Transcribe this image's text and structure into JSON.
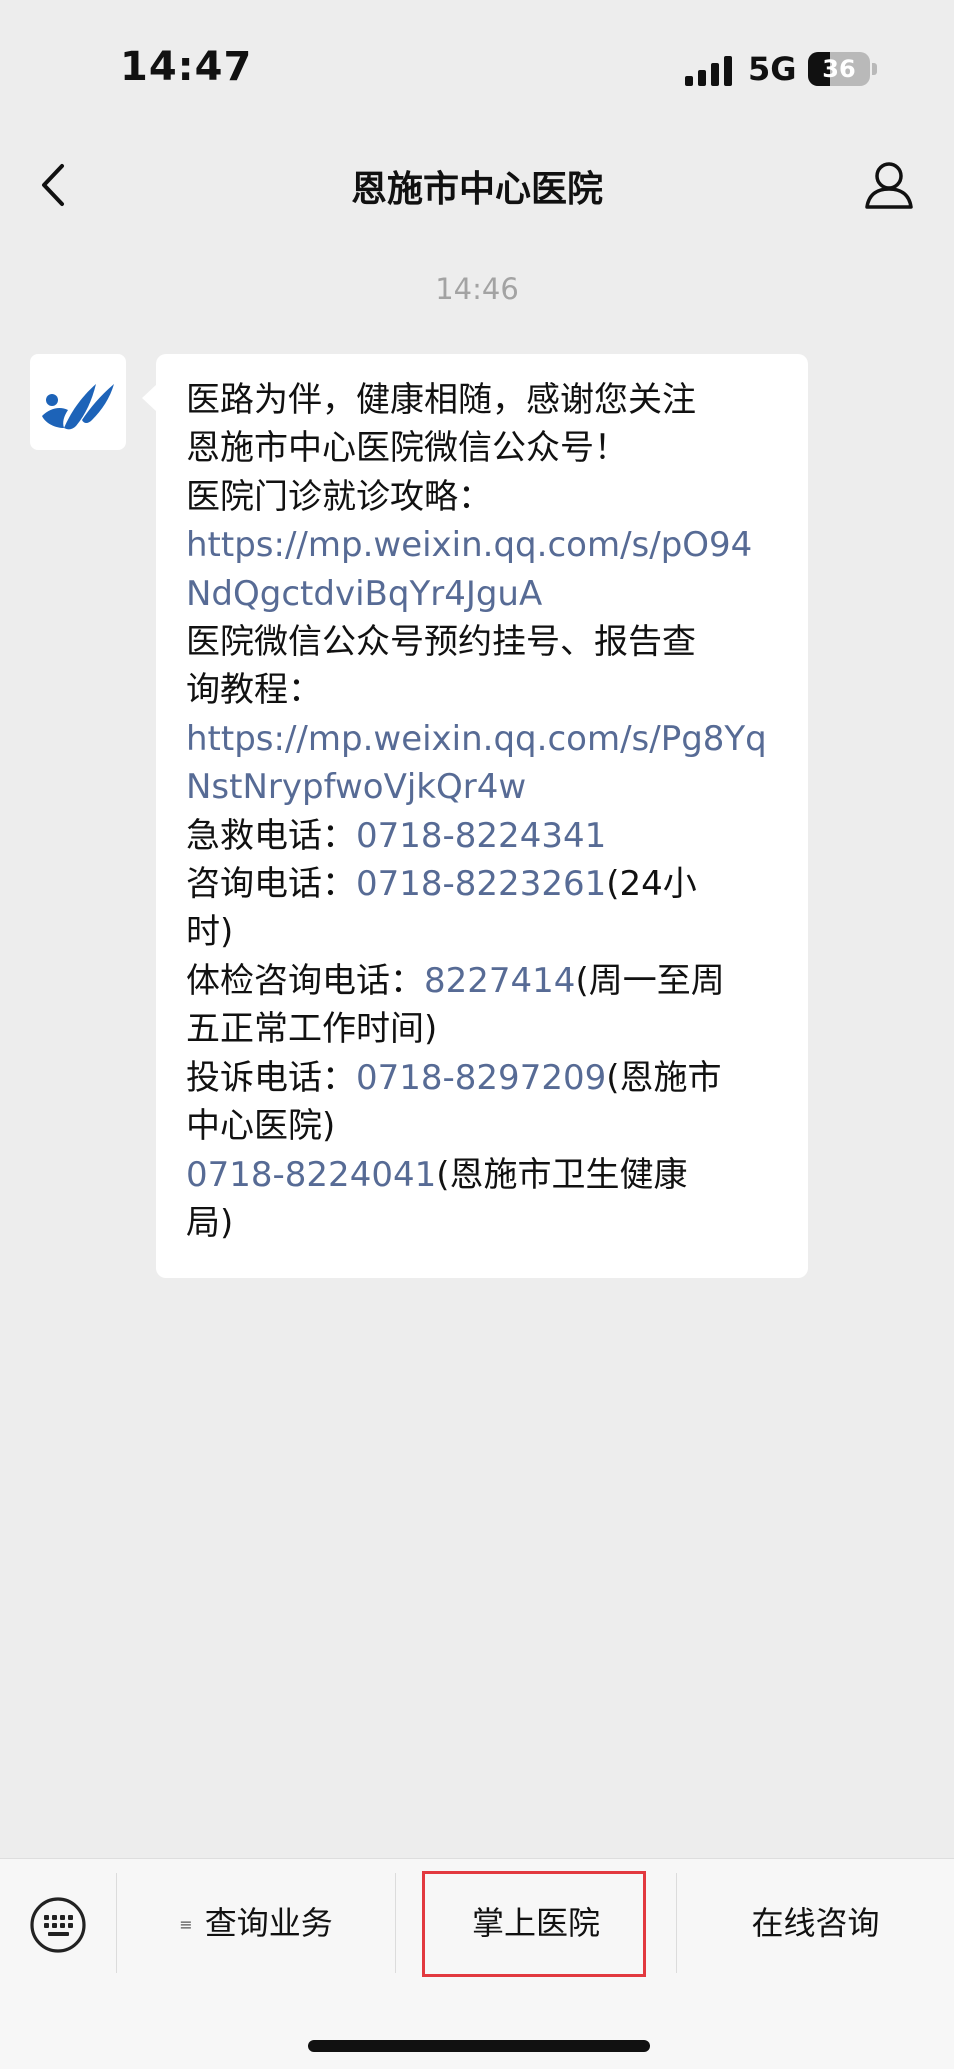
{
  "status_bar": {
    "time": "14:47",
    "network": "5G",
    "battery": "36"
  },
  "nav": {
    "title": "恩施市中心医院"
  },
  "chat": {
    "timestamp": "14:46",
    "message": {
      "lines": [
        [
          {
            "text": "医路为伴，健康相随，感谢您关注"
          }
        ],
        [
          {
            "text": "恩施市中心医院微信公众号！"
          }
        ],
        [
          {
            "text": "医院门诊就诊攻略："
          }
        ],
        [
          {
            "text": "https://mp.weixin.qq.com/s/pO94",
            "link": true
          }
        ],
        [
          {
            "text": "NdQgctdviBqYr4JguA",
            "link": true
          }
        ],
        [
          {
            "text": "医院微信公众号预约挂号、报告查"
          }
        ],
        [
          {
            "text": "询教程："
          }
        ],
        [
          {
            "text": "https://mp.weixin.qq.com/s/Pg8Yq",
            "link": true
          }
        ],
        [
          {
            "text": "NstNrypfwoVjkQr4w",
            "link": true
          }
        ],
        [
          {
            "text": "急救电话："
          },
          {
            "text": "0718-8224341",
            "link": true
          }
        ],
        [
          {
            "text": "咨询电话："
          },
          {
            "text": "0718-8223261",
            "link": true
          },
          {
            "text": "(24小"
          }
        ],
        [
          {
            "text": "时)"
          }
        ],
        [
          {
            "text": "体检咨询电话："
          },
          {
            "text": "8227414",
            "link": true
          },
          {
            "text": "(周一至周"
          }
        ],
        [
          {
            "text": "五正常工作时间)"
          }
        ],
        [
          {
            "text": "投诉电话："
          },
          {
            "text": "0718-8297209",
            "link": true
          },
          {
            "text": "(恩施市"
          }
        ],
        [
          {
            "text": "中心医院)"
          }
        ],
        [
          {
            "text": "0718-8224041",
            "link": true
          },
          {
            "text": "(恩施市卫生健康"
          }
        ],
        [
          {
            "text": "局)"
          }
        ]
      ]
    }
  },
  "menu": {
    "items": [
      {
        "label": "查询业务",
        "has_submenu": true
      },
      {
        "label": "掌上医院",
        "has_submenu": false
      },
      {
        "label": "在线咨询",
        "has_submenu": false
      }
    ],
    "submenu_icon": "≡"
  },
  "colors": {
    "link": "#576b95",
    "background": "#ededed",
    "highlight": "#e2393f"
  }
}
